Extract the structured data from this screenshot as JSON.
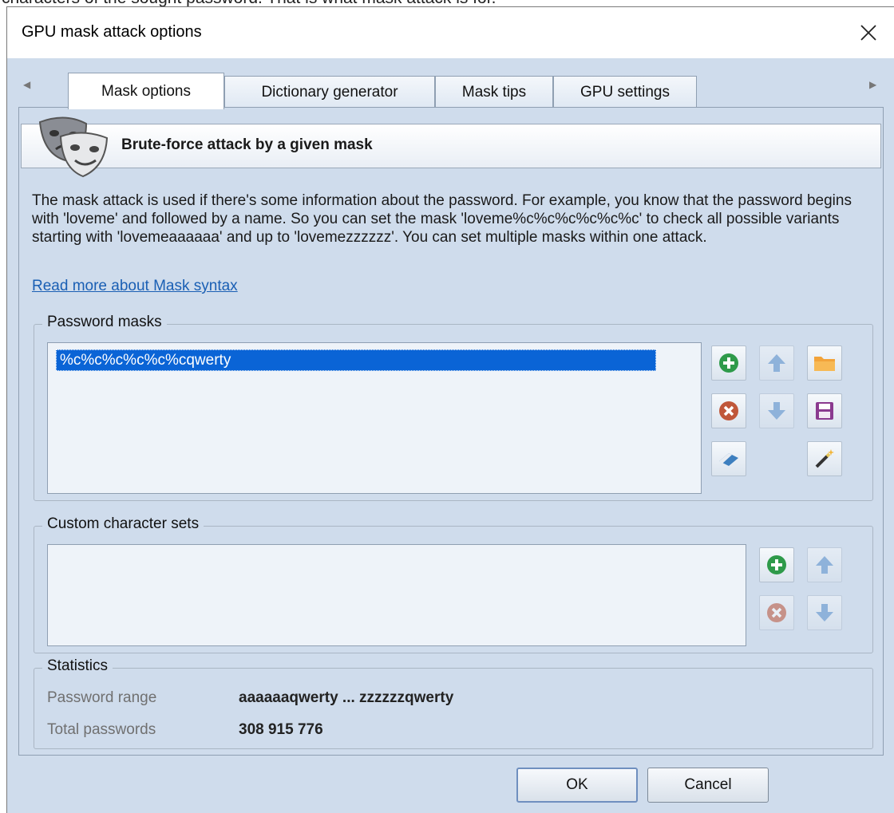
{
  "doc_clipped_text": "characters of the sought password. That is what mask attack is for.",
  "window": {
    "title": "GPU mask attack options"
  },
  "tabs": [
    {
      "label": "Mask options",
      "active": true
    },
    {
      "label": "Dictionary generator",
      "active": false
    },
    {
      "label": "Mask tips",
      "active": false
    },
    {
      "label": "GPU settings",
      "active": false
    }
  ],
  "header": {
    "title": "Brute-force attack by a given mask"
  },
  "description": "The mask attack is used if there's some information about the password. For example, you know that the password begins with 'loveme' and followed by a name. So you can set the mask 'loveme%c%c%c%c%c%c' to check all possible variants starting with 'lovemeaaaaaa' and up to 'lovemezzzzzz'. You can set multiple masks within one attack.",
  "link": "Read more about Mask syntax",
  "password_masks": {
    "title": "Password masks",
    "items": [
      "%c%c%c%c%c%cqwerty"
    ]
  },
  "custom_sets": {
    "title": "Custom character sets",
    "items": []
  },
  "statistics": {
    "title": "Statistics",
    "range_label": "Password range",
    "range_value": "aaaaaaqwerty ... zzzzzzqwerty",
    "total_label": "Total passwords",
    "total_value": "308 915 776"
  },
  "buttons": {
    "ok": "OK",
    "cancel": "Cancel"
  },
  "icons": {
    "add": "add-icon",
    "remove": "remove-icon",
    "up": "arrow-up-icon",
    "down": "arrow-down-icon",
    "open": "folder-icon",
    "save": "save-icon",
    "clear": "eraser-icon",
    "wizard": "magic-wand-icon",
    "close": "close-icon",
    "masks": "theater-masks-icon"
  },
  "colors": {
    "accent": "#0a64d6",
    "add": "#2e9a4a",
    "remove": "#c0573a",
    "arrow": "#5a90cc",
    "link": "#1a5fb4"
  }
}
